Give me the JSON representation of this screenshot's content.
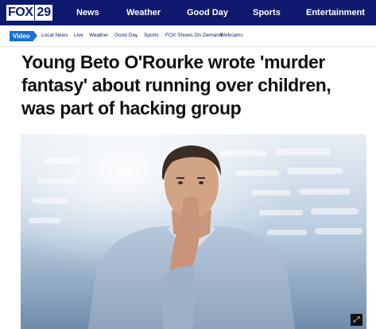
{
  "header": {
    "logo": {
      "brand": "FOX",
      "number": "29"
    },
    "nav": [
      "News",
      "Weather",
      "Good Day",
      "Sports",
      "Entertainment"
    ]
  },
  "subnav": {
    "section_tag": "Video",
    "items": [
      "Local News",
      "Live",
      "Weather",
      "Good Day",
      "Sports",
      "FOX Shows On Demand",
      "Webcams"
    ]
  },
  "article": {
    "headline": "Young Beto O'Rourke wrote 'murder fantasy' about running over children, was part of hacking group"
  },
  "media": {
    "expand_icon": "expand-icon"
  },
  "colors": {
    "brand_navy": "#0e1a6e",
    "video_blue": "#1d6fd1"
  }
}
